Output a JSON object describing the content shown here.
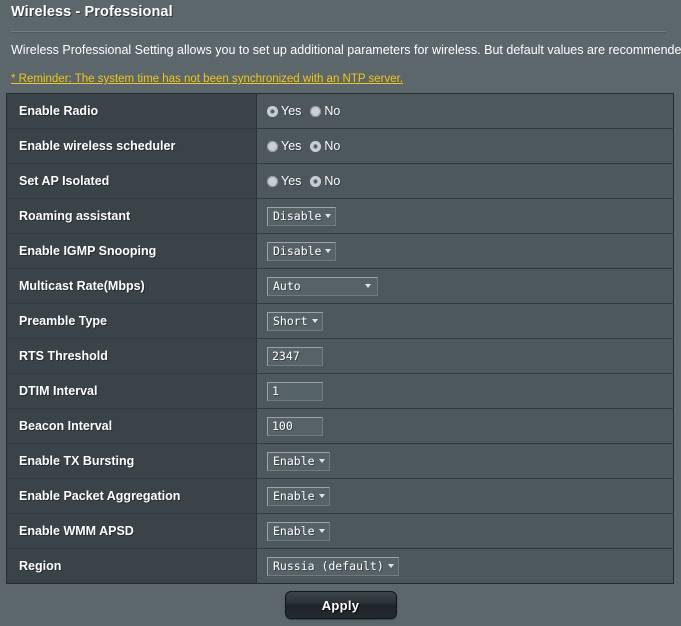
{
  "header": {
    "title": "Wireless - Professional",
    "description": "Wireless Professional Setting allows you to set up additional parameters for wireless. But default values are recommended.",
    "reminder": "* Reminder: The system time has not been synchronized with an NTP server."
  },
  "radio_labels": {
    "yes": "Yes",
    "no": "No"
  },
  "rows": [
    {
      "label": "Enable Radio",
      "type": "radio",
      "value": "Yes"
    },
    {
      "label": "Enable wireless scheduler",
      "type": "radio",
      "value": "No"
    },
    {
      "label": "Set AP Isolated",
      "type": "radio",
      "value": "No"
    },
    {
      "label": "Roaming assistant",
      "type": "select",
      "value": "Disable"
    },
    {
      "label": "Enable IGMP Snooping",
      "type": "select",
      "value": "Disable"
    },
    {
      "label": "Multicast Rate(Mbps)",
      "type": "select",
      "value": "Auto",
      "wide": true
    },
    {
      "label": "Preamble Type",
      "type": "select",
      "value": "Short"
    },
    {
      "label": "RTS Threshold",
      "type": "input",
      "value": "2347"
    },
    {
      "label": "DTIM Interval",
      "type": "input",
      "value": "1"
    },
    {
      "label": "Beacon Interval",
      "type": "input",
      "value": "100"
    },
    {
      "label": "Enable TX Bursting",
      "type": "select",
      "value": "Enable"
    },
    {
      "label": "Enable Packet Aggregation",
      "type": "select",
      "value": "Enable"
    },
    {
      "label": "Enable WMM APSD",
      "type": "select",
      "value": "Enable"
    },
    {
      "label": "Region",
      "type": "select",
      "value": "Russia (default)"
    }
  ],
  "footer": {
    "apply_label": "Apply"
  },
  "colors": {
    "page_bg": "#5b676b",
    "label_cell_bg": "#3a4448",
    "value_cell_bg": "#4c585c",
    "reminder": "#f2c51c",
    "text": "#ffffff"
  }
}
